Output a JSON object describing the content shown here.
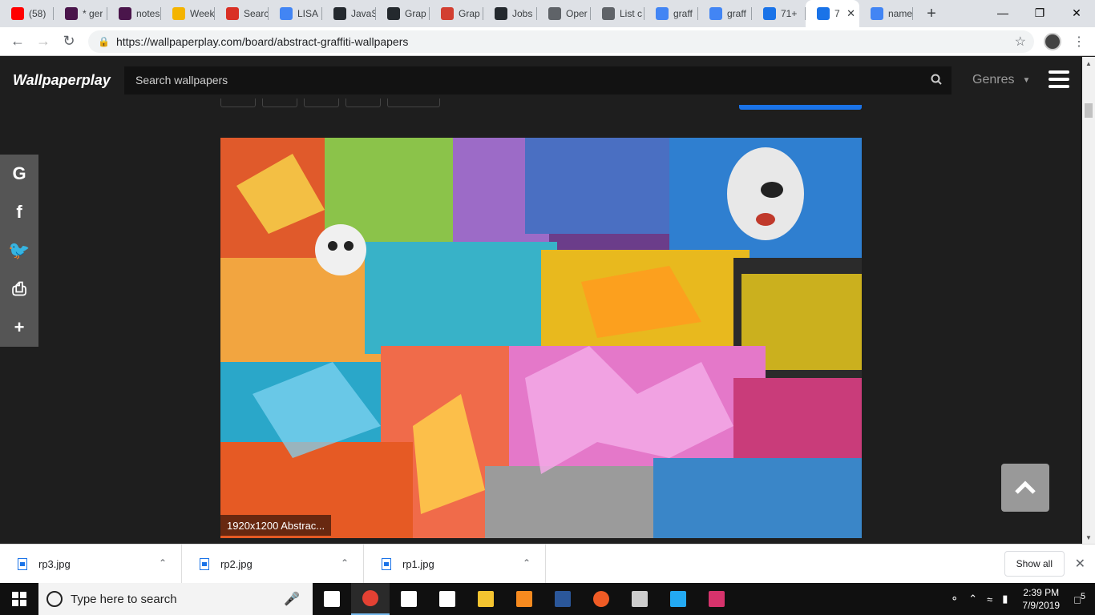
{
  "browser": {
    "tabs": [
      {
        "label": "(58)",
        "icon": "youtube-icon",
        "color": "#ff0000"
      },
      {
        "label": "* ger",
        "icon": "slack-icon",
        "color": "#4a154b"
      },
      {
        "label": "notes",
        "icon": "slack-icon",
        "color": "#4a154b"
      },
      {
        "label": "Week",
        "icon": "slides-icon",
        "color": "#f4b400"
      },
      {
        "label": "Searc",
        "icon": "gmail-icon",
        "color": "#d93025"
      },
      {
        "label": "LISA",
        "icon": "docs-icon",
        "color": "#4285f4"
      },
      {
        "label": "JavaS",
        "icon": "github-icon",
        "color": "#24292e"
      },
      {
        "label": "Grap",
        "icon": "pinterest-icon",
        "color": "#24292e"
      },
      {
        "label": "Grap",
        "icon": "bookmark-icon",
        "color": "#d23f31"
      },
      {
        "label": "Jobs",
        "icon": "jobs-icon",
        "color": "#24292e"
      },
      {
        "label": "Oper",
        "icon": "globe-icon",
        "color": "#5f6368"
      },
      {
        "label": "List c",
        "icon": "globe-icon",
        "color": "#5f6368"
      },
      {
        "label": "graff",
        "icon": "google-icon",
        "color": "#4285f4"
      },
      {
        "label": "graff",
        "icon": "google-icon",
        "color": "#4285f4"
      },
      {
        "label": "71+",
        "icon": "star-icon",
        "color": "#1a73e8"
      },
      {
        "label": "7",
        "icon": "star-icon",
        "color": "#1a73e8",
        "active": true
      },
      {
        "label": "name",
        "icon": "google-icon",
        "color": "#4285f4"
      }
    ],
    "new_tab": "+",
    "url": "https://wallpaperplay.com/board/abstract-graffiti-wallpapers"
  },
  "site": {
    "logo": "Wallpaperplay",
    "search_placeholder": "Search wallpapers",
    "genres_label": "Genres",
    "image_caption": "1920x1200 Abstrac...",
    "share_buttons": [
      {
        "icon": "google-icon",
        "glyph": "G"
      },
      {
        "icon": "facebook-icon",
        "glyph": "f"
      },
      {
        "icon": "twitter-icon",
        "glyph": "🐦"
      },
      {
        "icon": "print-icon",
        "glyph": "⎙"
      },
      {
        "icon": "plus-icon",
        "glyph": "+"
      }
    ]
  },
  "downloads": {
    "items": [
      "rp3.jpg",
      "rp2.jpg",
      "rp1.jpg"
    ],
    "show_all": "Show all"
  },
  "taskbar": {
    "search_placeholder": "Type here to search",
    "apps": [
      "task-view-icon",
      "chrome-icon",
      "store-icon",
      "mail-icon",
      "explorer-icon",
      "sublime-icon",
      "word-icon",
      "postman-icon",
      "terminal-icon",
      "vscode-icon",
      "indesign-icon"
    ],
    "time": "2:39 PM",
    "date": "7/9/2019",
    "notifications": "5"
  }
}
